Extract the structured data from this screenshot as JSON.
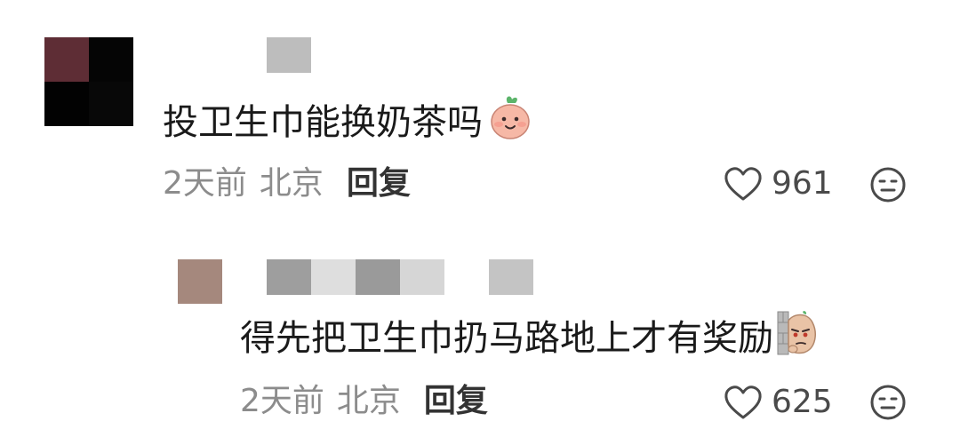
{
  "comments": [
    {
      "text": "投卫生巾能换奶茶吗",
      "time": "2天前",
      "location": "北京",
      "reply_label": "回复",
      "likes": "961",
      "emoji": "peach-smile-emoji"
    },
    {
      "text": "得先把卫生巾扔马路地上才有奖励",
      "time": "2天前",
      "location": "北京",
      "reply_label": "回复",
      "likes": "625",
      "emoji": "peeking-bean-emoji"
    }
  ],
  "icons": {
    "like": "heart-outline-icon",
    "dislike": "meh-face-icon"
  },
  "colors": {
    "text": "#1a1a1a",
    "meta": "#8c8c8c",
    "reply": "#333333",
    "icon": "#4a4a4a",
    "avatar_1": [
      "#5e2d35",
      "#000000",
      "#000000",
      "#000000"
    ],
    "avatar_2": "#a5887d"
  }
}
